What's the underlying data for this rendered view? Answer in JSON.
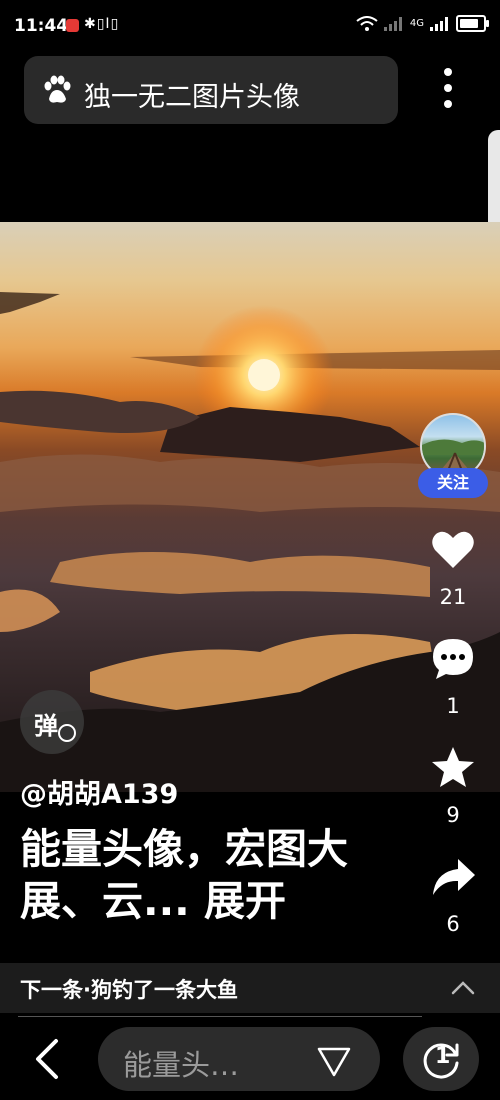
{
  "status_bar": {
    "time": "11:44",
    "left_icons": "✱▯Ⅰ▯",
    "network": "4G"
  },
  "search": {
    "text": "独一无二图片头像",
    "paw_icon": "paw-icon"
  },
  "content": {
    "author": "@胡胡A139",
    "title": "能量头像，宏图大展、云... 展开",
    "danmu_label": "弹"
  },
  "actions": {
    "follow_label": "关注",
    "like_count": "21",
    "comment_count": "1",
    "star_count": "9",
    "share_count": "6"
  },
  "next": {
    "label": "下一条·狗钓了一条大鱼"
  },
  "bottom": {
    "search_pill_text": "能量头…",
    "counter_value": "1"
  },
  "colors": {
    "follow": "#3b5de7",
    "status_badge": "#e53935",
    "bar": "#1c1c1c",
    "pill": "#2c2c2c"
  }
}
